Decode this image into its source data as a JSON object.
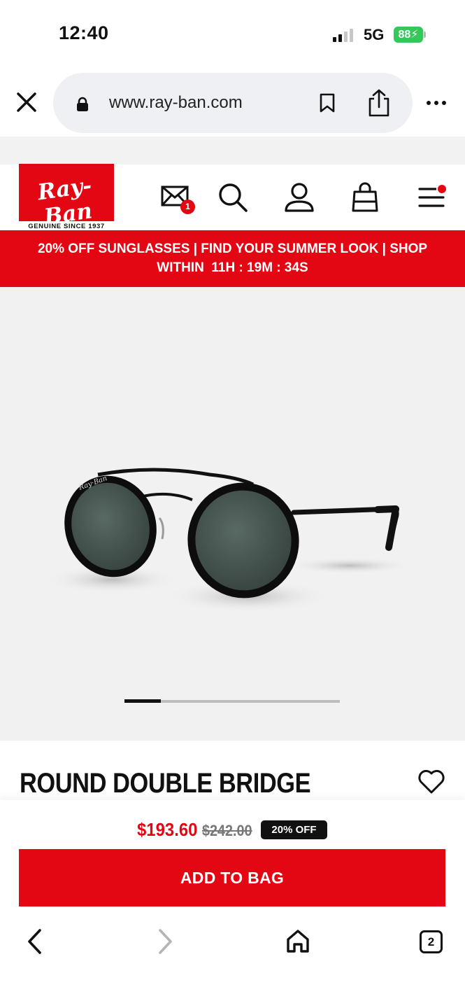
{
  "status_bar": {
    "time": "12:40",
    "network": "5G",
    "battery": "88"
  },
  "browser": {
    "url": "www.ray-ban.com",
    "tab_count": "2",
    "icons": [
      "close-icon",
      "lock-icon",
      "bookmark-icon",
      "share-icon",
      "more-icon",
      "back-icon",
      "forward-icon",
      "home-icon",
      "tabs-icon"
    ]
  },
  "header": {
    "logo_text": "Ray-Ban",
    "logo_tagline": "GENUINE SINCE 1937",
    "mail_badge": "1",
    "icons": [
      "mail-icon",
      "search-icon",
      "account-icon",
      "bag-icon",
      "menu-icon"
    ]
  },
  "promo": {
    "line1": "20% OFF SUNGLASSES | FIND YOUR SUMMER LOOK | SHOP",
    "line2": "WITHIN  11H : 19M : 34S"
  },
  "product": {
    "image": "sunglasses-image",
    "carousel_active_index": 0,
    "title": "ROUND DOUBLE BRIDGE",
    "price_now": "$193.60",
    "price_was": "$242.00",
    "discount": "20% OFF",
    "add_to_bag": "ADD TO BAG"
  },
  "colors": {
    "brand_red": "#e30613",
    "battery_green": "#34c759",
    "image_bg": "#f1f1f2"
  }
}
